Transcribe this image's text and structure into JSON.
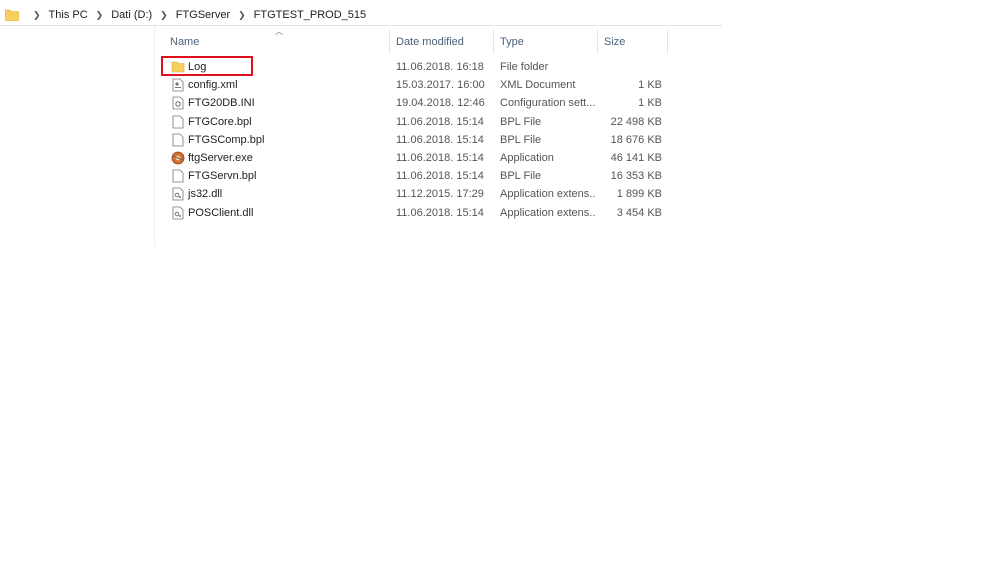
{
  "breadcrumb": [
    "This PC",
    "Dati (D:)",
    "FTGServer",
    "FTGTEST_PROD_515"
  ],
  "columns": {
    "name": "Name",
    "date": "Date modified",
    "type": "Type",
    "size": "Size"
  },
  "files": [
    {
      "name": "Log",
      "date": "11.06.2018. 16:18",
      "type": "File folder",
      "size": "",
      "icon": "folder-icon"
    },
    {
      "name": "config.xml",
      "date": "15.03.2017. 16:00",
      "type": "XML Document",
      "size": "1 KB",
      "icon": "xml-file-icon"
    },
    {
      "name": "FTG20DB.INI",
      "date": "19.04.2018. 12:46",
      "type": "Configuration sett...",
      "size": "1 KB",
      "icon": "config-file-icon"
    },
    {
      "name": "FTGCore.bpl",
      "date": "11.06.2018. 15:14",
      "type": "BPL File",
      "size": "22 498 KB",
      "icon": "file-icon"
    },
    {
      "name": "FTGSComp.bpl",
      "date": "11.06.2018. 15:14",
      "type": "BPL File",
      "size": "18 676 KB",
      "icon": "file-icon"
    },
    {
      "name": "ftgServer.exe",
      "date": "11.06.2018. 15:14",
      "type": "Application",
      "size": "46 141 KB",
      "icon": "application-icon"
    },
    {
      "name": "FTGServn.bpl",
      "date": "11.06.2018. 15:14",
      "type": "BPL File",
      "size": "16 353 KB",
      "icon": "file-icon"
    },
    {
      "name": "js32.dll",
      "date": "11.12.2015. 17:29",
      "type": "Application extens...",
      "size": "1 899 KB",
      "icon": "dll-file-icon"
    },
    {
      "name": "POSClient.dll",
      "date": "11.06.2018. 15:14",
      "type": "Application extens...",
      "size": "3 454 KB",
      "icon": "dll-file-icon"
    }
  ],
  "colors": {
    "highlight": "#e0101e",
    "header_text": "#4c607a",
    "folder": "#f6cf5c"
  }
}
